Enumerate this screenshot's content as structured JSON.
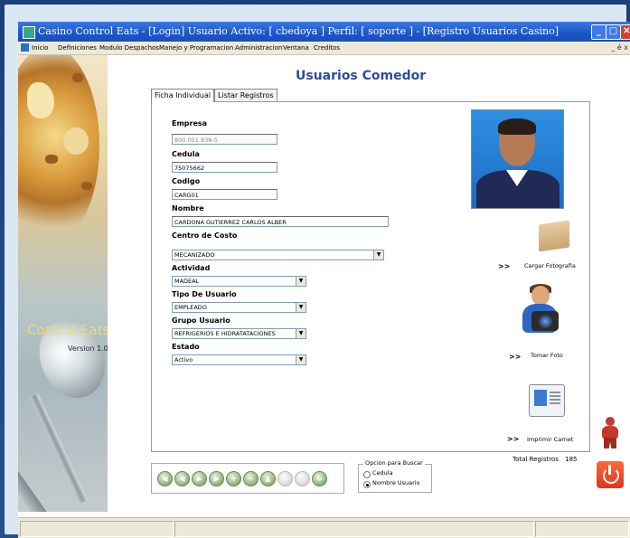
{
  "window": {
    "title": "Casino Control Eats  - [Login] Usuario Activo: [ cbedoya ]  Perfil: [ soporte ] - [Registro Usuarios Casino]"
  },
  "menu": {
    "items": [
      "Inicio",
      "Definiciones",
      "Modulo Despachos",
      "Manejo y Programacion",
      "Administracion",
      "Ventana",
      "Creditos"
    ],
    "mdi_controls": "_ é x"
  },
  "sidebar": {
    "brand": "Control Eats",
    "version": "Version 1.0"
  },
  "page": {
    "heading": "Usuarios Comedor"
  },
  "tabs": [
    {
      "label": "Ficha Individual",
      "active": true
    },
    {
      "label": "Listar Registros",
      "active": false
    }
  ],
  "form": {
    "empresa_label": "Empresa",
    "empresa_value": "800.051.838-5",
    "cedula_label": "Cedula",
    "cedula_value": "75075662",
    "codigo_label": "Codigo",
    "codigo_value": "CARG01",
    "nombre_label": "Nombre",
    "nombre_value": "CARDONA GUTIERREZ CARLOS ALBER",
    "centro_label": "Centro de Costo",
    "centro_value": "MECANIZADO",
    "actividad_label": "Actividad",
    "actividad_value": "MADEAL",
    "tipo_label": "Tipo De Usuario",
    "tipo_value": "EMPLEADO",
    "grupo_label": "Grupo Usuario",
    "grupo_value": "REFRIGERIOS E HIDRATATACIONES",
    "estado_label": "Estado",
    "estado_value": "Activo"
  },
  "actions": {
    "arrows": ">>",
    "cargar_foto": "Cargar Fotografia",
    "tomar_foto": "Tomar Foto",
    "imprimir_carnet": "Imprimir Carnet"
  },
  "search": {
    "legend": "Opcion para Buscar",
    "options": [
      {
        "label": "Cedula",
        "selected": false
      },
      {
        "label": "Nombre Usuario",
        "selected": true
      }
    ]
  },
  "totals": {
    "label": "Total Registros",
    "value": "185"
  },
  "nav_buttons": [
    {
      "icon": "first-icon",
      "glyph": "◀"
    },
    {
      "icon": "previous-icon",
      "glyph": "◀"
    },
    {
      "icon": "next-icon",
      "glyph": "▶"
    },
    {
      "icon": "last-icon",
      "glyph": "▶"
    },
    {
      "icon": "add-icon",
      "glyph": "+"
    },
    {
      "icon": "remove-icon",
      "glyph": "−"
    },
    {
      "icon": "edit-icon",
      "glyph": "▲"
    },
    {
      "icon": "confirm-icon",
      "glyph": "✓"
    },
    {
      "icon": "cancel-icon",
      "glyph": "✕"
    },
    {
      "icon": "refresh-icon",
      "glyph": "↻"
    }
  ],
  "colors": {
    "titlebar": "#1d55c8",
    "heading": "#2d4d9a",
    "nav_button": "#8fb076",
    "power_button": "#e0351a"
  }
}
